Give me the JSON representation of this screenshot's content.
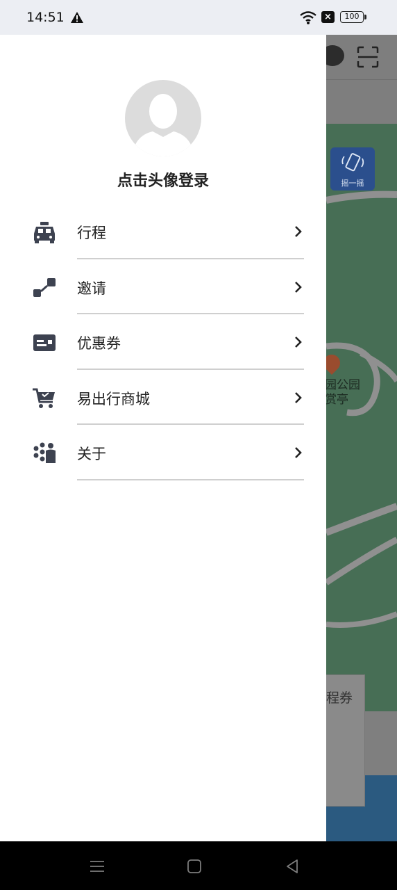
{
  "status_bar": {
    "time": "14:51",
    "battery": "100"
  },
  "background": {
    "shake_label": "摇一摇",
    "poi_line1": "园公园",
    "poi_line2": "赏亭",
    "card_label": "程券"
  },
  "drawer": {
    "login_prompt": "点击头像登录",
    "menu": [
      {
        "label": "行程",
        "icon": "taxi-icon"
      },
      {
        "label": "邀请",
        "icon": "share-nodes-icon"
      },
      {
        "label": "优惠券",
        "icon": "coupon-card-icon"
      },
      {
        "label": "易出行商城",
        "icon": "shopping-cart-icon"
      },
      {
        "label": "关于",
        "icon": "about-people-icon"
      }
    ]
  },
  "colors": {
    "icon": "#3d4250",
    "divider": "#cfcfcf",
    "overlay": "#7f7f7f"
  }
}
